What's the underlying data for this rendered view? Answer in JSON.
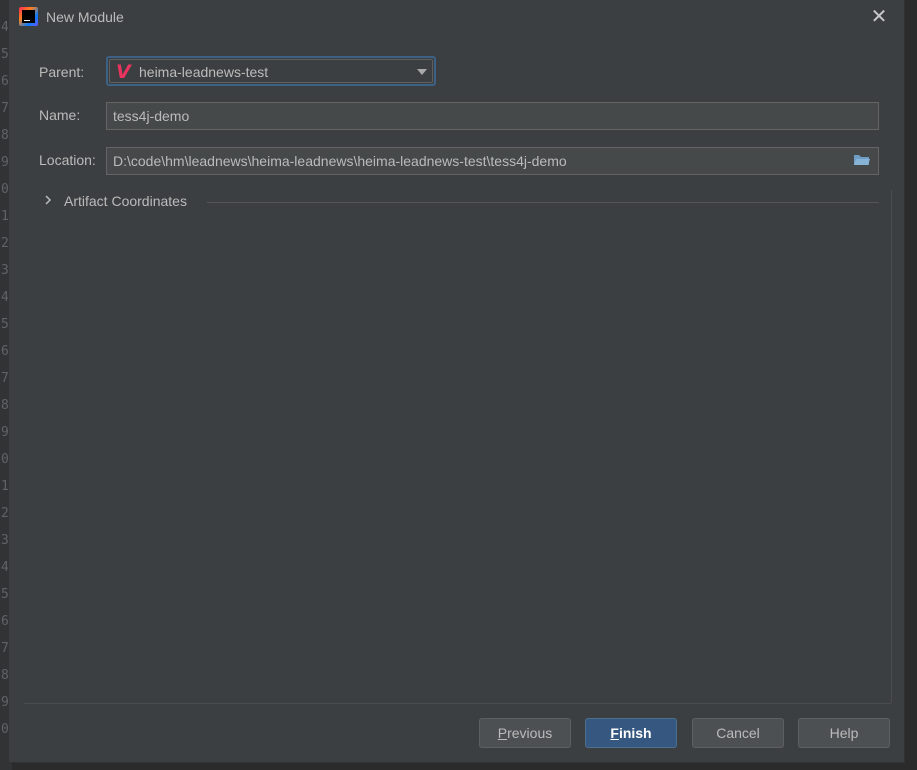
{
  "dialog": {
    "title": "New Module",
    "close_glyph": "✕"
  },
  "form": {
    "parent_label": "Parent:",
    "parent_value": "heima-leadnews-test",
    "parent_icon": "maven-icon",
    "name_label": "Name:",
    "name_value": "tess4j-demo",
    "location_label": "Location:",
    "location_value": "D:\\code\\hm\\leadnews\\heima-leadnews\\heima-leadnews-test\\tess4j-demo",
    "artifact_section": "Artifact Coordinates"
  },
  "buttons": {
    "previous_mn": "P",
    "previous_rest": "revious",
    "finish_mn": "F",
    "finish_rest": "inish",
    "cancel": "Cancel",
    "help": "Help"
  },
  "colors": {
    "dialog_bg": "#3c3f41",
    "primary_button": "#365880",
    "focus_border": "#3d6185",
    "maven_icon": "#e8345f"
  }
}
